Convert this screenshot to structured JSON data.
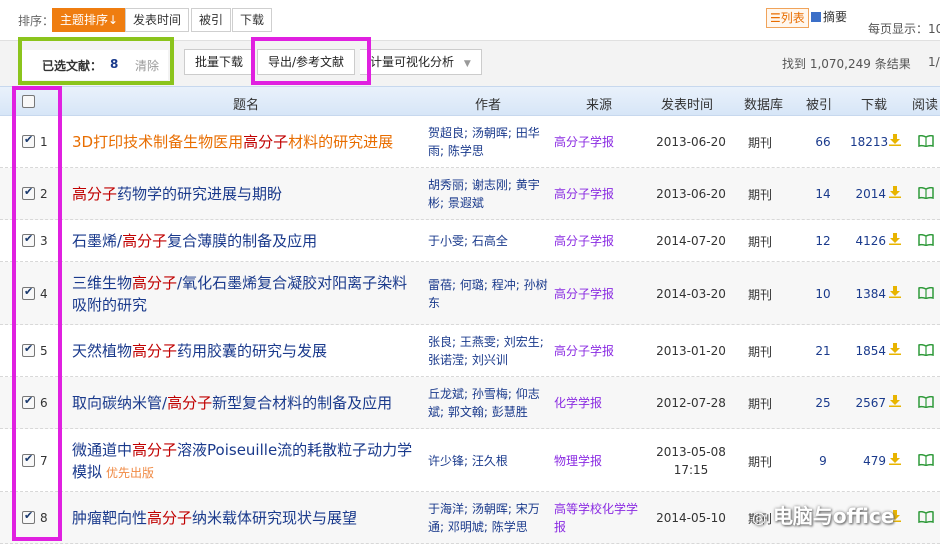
{
  "sortbar": {
    "label": "排序：",
    "buttons": [
      "主题排序",
      "发表时间",
      "被引",
      "下载"
    ],
    "active_arrow": "↓",
    "view_list": "列表",
    "view_abstract": "摘要",
    "per_page_label": "每页显示：10"
  },
  "toolbar": {
    "selected_label": "已选文献：",
    "selected_count": "8",
    "clear_label": "清除",
    "batch_download": "批量下载",
    "export": "导出/参考文献",
    "visual_analysis": "计量可视化分析",
    "result_count": "找到 1,070,249 条结果",
    "page_indicator": "1/"
  },
  "table": {
    "headers": [
      "题名",
      "作者",
      "来源",
      "发表时间",
      "数据库",
      "被引",
      "下载",
      "阅读"
    ],
    "rows": [
      {
        "num": "1",
        "title_parts": [
          [
            "3D打印技术制备生物医用",
            ""
          ],
          [
            "高分子",
            "hl"
          ],
          [
            "材料的研究进展",
            ""
          ]
        ],
        "tag": "",
        "authors": "贺超良; 汤朝晖; 田华雨; 陈学思",
        "source": "高分子学报",
        "date": "2013-06-20",
        "db": "期刊",
        "cite": "66",
        "download": "18213"
      },
      {
        "num": "2",
        "title_parts": [
          [
            "高分子",
            "hl"
          ],
          [
            "药物学的研究进展与期盼",
            ""
          ]
        ],
        "tag": "",
        "authors": "胡秀丽; 谢志刚; 黄宇彬; 景遐斌",
        "source": "高分子学报",
        "date": "2013-06-20",
        "db": "期刊",
        "cite": "14",
        "download": "2014"
      },
      {
        "num": "3",
        "title_parts": [
          [
            "石墨烯/",
            ""
          ],
          [
            "高分子",
            "hl"
          ],
          [
            "复合薄膜的制备及应用",
            ""
          ]
        ],
        "tag": "",
        "authors": "于小雯; 石高全",
        "source": "高分子学报",
        "date": "2014-07-20",
        "db": "期刊",
        "cite": "12",
        "download": "4126"
      },
      {
        "num": "4",
        "title_parts": [
          [
            "三维生物",
            ""
          ],
          [
            "高分子",
            "hl"
          ],
          [
            "/氧化石墨烯复合凝胶对阳离子染料吸附的研究",
            ""
          ]
        ],
        "tag": "",
        "authors": "雷蓓; 何璐; 程冲; 孙树东",
        "source": "高分子学报",
        "date": "2014-03-20",
        "db": "期刊",
        "cite": "10",
        "download": "1384"
      },
      {
        "num": "5",
        "title_parts": [
          [
            "天然植物",
            ""
          ],
          [
            "高分子",
            "hl"
          ],
          [
            "药用胶囊的研究与发展",
            ""
          ]
        ],
        "tag": "",
        "authors": "张良; 王燕雯; 刘宏生; 张诺滢; 刘兴训",
        "source": "高分子学报",
        "date": "2013-01-20",
        "db": "期刊",
        "cite": "21",
        "download": "1854"
      },
      {
        "num": "6",
        "title_parts": [
          [
            "取向碳纳米管/",
            ""
          ],
          [
            "高分子",
            "hl"
          ],
          [
            "新型复合材料的制备及应用",
            ""
          ]
        ],
        "tag": "",
        "authors": "丘龙斌; 孙雪梅; 仰志斌; 郭文翰; 彭慧胜",
        "source": "化学学报",
        "date": "2012-07-28",
        "db": "期刊",
        "cite": "25",
        "download": "2567"
      },
      {
        "num": "7",
        "title_parts": [
          [
            "微通道中",
            ""
          ],
          [
            "高分子",
            "hl"
          ],
          [
            "溶液Poiseuille流的耗散粒子动力学模拟",
            ""
          ]
        ],
        "tag": "优先出版",
        "authors": "许少锋; 汪久根",
        "source": "物理学报",
        "date": "2013-05-08 17:15",
        "db": "期刊",
        "cite": "9",
        "download": "479"
      },
      {
        "num": "8",
        "title_parts": [
          [
            "肿瘤靶向性",
            ""
          ],
          [
            "高分子",
            "hl"
          ],
          [
            "纳米载体研究现状与展望",
            ""
          ]
        ],
        "tag": "",
        "authors": "于海洋; 汤朝晖; 宋万通; 邓明虓; 陈学思",
        "source": "高等学校化学学报",
        "date": "2014-05-10",
        "db": "期刊",
        "cite": "",
        "download": ""
      }
    ]
  },
  "watermark": "电脑与office",
  "colors": {
    "active_sort": "#ef7d10",
    "title_link": "#1a3a8c",
    "keyword_highlight": "#c00000",
    "source_link": "#8a2be2",
    "green_box": "#8bc41c",
    "magenta_box": "#e020e0"
  }
}
